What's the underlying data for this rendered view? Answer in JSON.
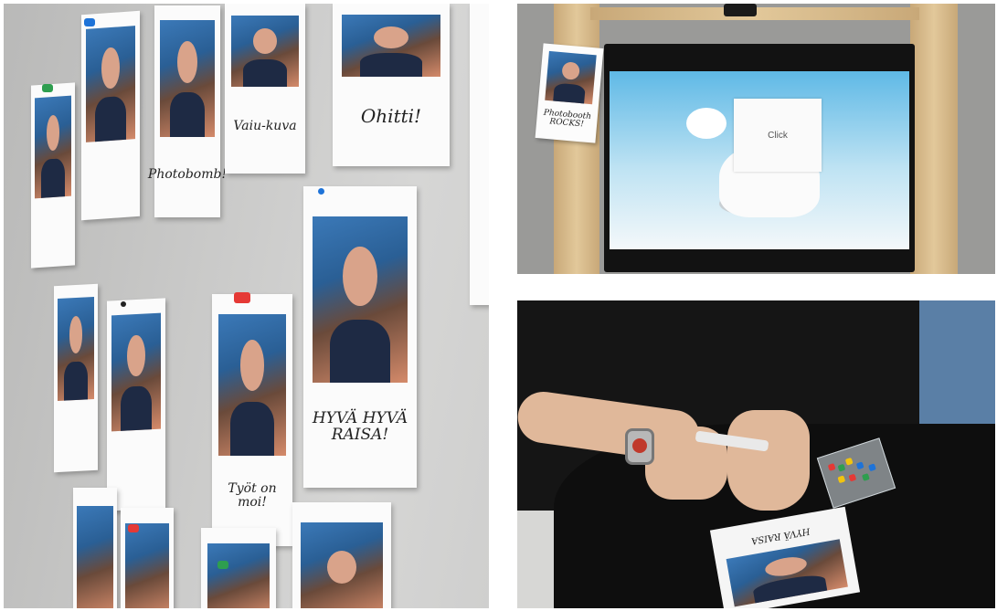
{
  "wall_captions": [
    "Photobomb!",
    "Vaiu-kuva",
    "Ohitti!",
    "HYVÄ HYVÄ RAISA!",
    "Työt on moi!"
  ],
  "kiosk": {
    "screen_button": "Click",
    "note_caption": "Photobooth ROCKS!"
  },
  "desk": {
    "card_caption": "HYVÄ RAISA"
  },
  "colors": {
    "pin_red": "#e53935",
    "pin_blue": "#1e73d8",
    "pin_green": "#2e9e4f",
    "wall": "#cfcfce"
  }
}
